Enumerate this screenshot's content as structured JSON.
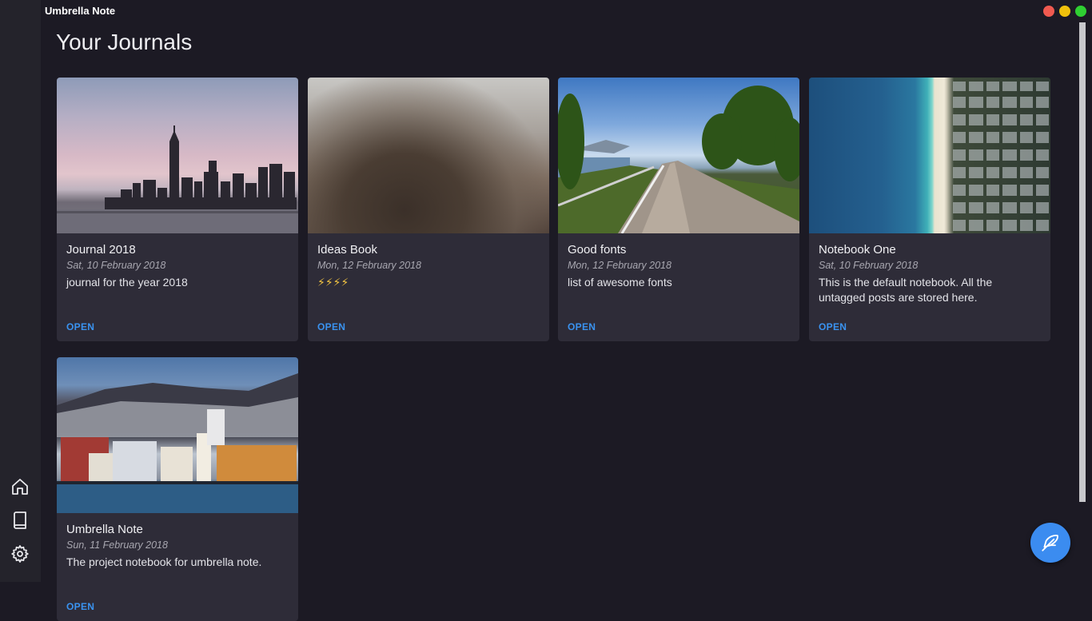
{
  "app": {
    "title": "Umbrella Note"
  },
  "window_controls": {
    "close_color": "#f05a50",
    "minimize_color": "#f0c10c",
    "maximize_color": "#2fcf32"
  },
  "sidebar": {
    "items": [
      {
        "name": "home",
        "icon": "home-icon"
      },
      {
        "name": "journals",
        "icon": "book-icon"
      },
      {
        "name": "settings",
        "icon": "gear-icon"
      }
    ]
  },
  "main": {
    "page_title": "Your Journals"
  },
  "journals": [
    {
      "title": "Journal 2018",
      "date": "Sat, 10 February 2018",
      "description": "journal for the year 2018",
      "action": "OPEN"
    },
    {
      "title": "Ideas Book",
      "date": "Mon, 12 February 2018",
      "description": "⚡⚡⚡⚡",
      "action": "OPEN"
    },
    {
      "title": "Good fonts",
      "date": "Mon, 12 February 2018",
      "description": "list of awesome fonts",
      "action": "OPEN"
    },
    {
      "title": "Notebook One",
      "date": "Sat, 10 February 2018",
      "description": "This is the default notebook. All the untagged posts are stored here.",
      "action": "OPEN"
    },
    {
      "title": "Umbrella Note",
      "date": "Sun, 11 February 2018",
      "description": "The project notebook for umbrella note.",
      "action": "OPEN"
    }
  ],
  "fab": {
    "icon": "feather-pen-icon"
  },
  "colors": {
    "accent": "#3b8cf0",
    "background": "#1c1a24",
    "card": "#2e2c38"
  }
}
